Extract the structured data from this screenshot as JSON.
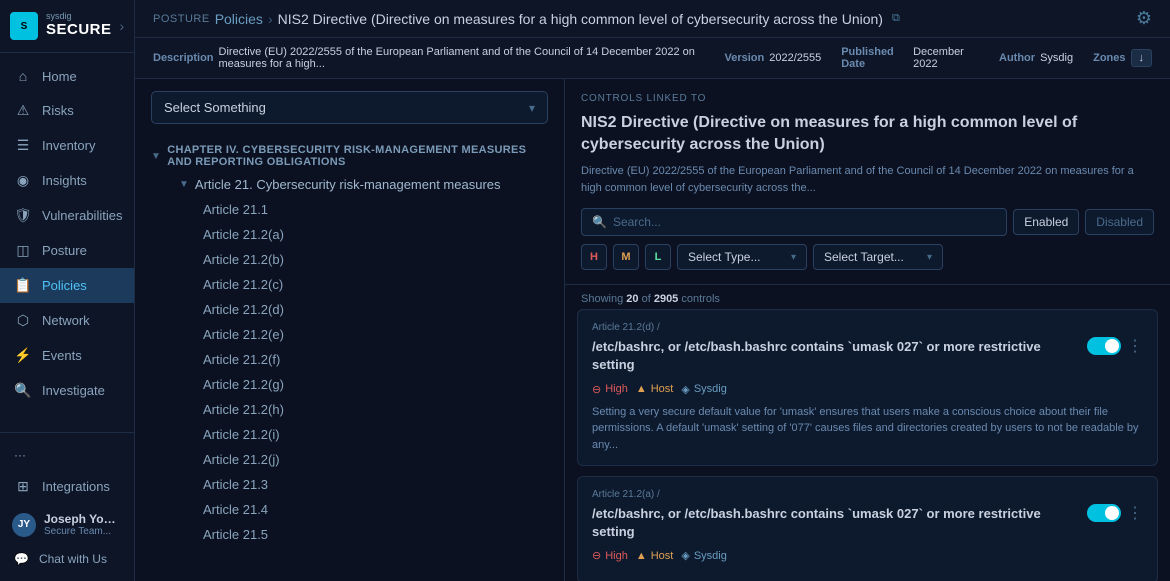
{
  "sidebar": {
    "logo": {
      "icon": "S",
      "brand": "SECURE",
      "sub": "sysdig"
    },
    "toggle_icon": "›",
    "items": [
      {
        "id": "home",
        "label": "Home",
        "icon": "⌂",
        "active": false
      },
      {
        "id": "risks",
        "label": "Risks",
        "icon": "⚠",
        "active": false
      },
      {
        "id": "inventory",
        "label": "Inventory",
        "icon": "☰",
        "active": false
      },
      {
        "id": "insights",
        "label": "Insights",
        "icon": "◉",
        "active": false
      },
      {
        "id": "vulnerabilities",
        "label": "Vulnerabilities",
        "icon": "🛡",
        "active": false
      },
      {
        "id": "posture",
        "label": "Posture",
        "icon": "◫",
        "active": false
      },
      {
        "id": "policies",
        "label": "Policies",
        "icon": "📋",
        "active": true
      },
      {
        "id": "network",
        "label": "Network",
        "icon": "⬡",
        "active": false
      },
      {
        "id": "events",
        "label": "Events",
        "icon": "⚡",
        "active": false
      },
      {
        "id": "investigate",
        "label": "Investigate",
        "icon": "🔍",
        "active": false
      }
    ],
    "bottom_items": [
      {
        "id": "integrations",
        "label": "Integrations",
        "icon": "⊞"
      }
    ],
    "user": {
      "initials": "JY",
      "name": "Joseph Yostos",
      "team": "Secure Team..."
    },
    "chat": {
      "label": "Chat with Us",
      "icon": "💬"
    },
    "dots_icon": "···"
  },
  "topbar": {
    "posture_label": "POSTURE",
    "breadcrumb": {
      "parent": "Policies",
      "separator": "›",
      "current": "NIS2 Directive (Directive on measures for a high common level of cybersecurity across the Union)",
      "ext_icon": "⧉"
    },
    "right_icon": "⚙"
  },
  "info_bar": {
    "description_label": "Description",
    "description_text": "Directive (EU) 2022/2555 of the European Parliament and of the Council of 14 December 2022 on measures for a high...",
    "version_label": "Version",
    "version_value": "2022/2555",
    "published_label": "Published Date",
    "published_value": "December 2022",
    "author_label": "Author",
    "author_value": "Sysdig",
    "zones_label": "Zones",
    "zones_suffix": "↓"
  },
  "left_panel": {
    "select_placeholder": "Select Something",
    "chapter": {
      "label": "CHAPTER IV. CYBERSECURITY RISK-MANAGEMENT MEASURES AND REPORTING OBLIGATIONS",
      "chevron": "▼"
    },
    "article_group": {
      "label": "Article 21. Cybersecurity risk-management measures",
      "chevron": "▼"
    },
    "articles": [
      "Article 21.1",
      "Article 21.2(a)",
      "Article 21.2(b)",
      "Article 21.2(c)",
      "Article 21.2(d)",
      "Article 21.2(e)",
      "Article 21.2(f)",
      "Article 21.2(g)",
      "Article 21.2(h)",
      "Article 21.2(i)",
      "Article 21.2(j)",
      "Article 21.3",
      "Article 21.4",
      "Article 21.5"
    ]
  },
  "right_panel": {
    "controls_label": "CONTROLS LINKED TO",
    "directive_title": "NIS2 Directive (Directive on measures for a high common level of cybersecurity across the Union)",
    "directive_desc": "Directive (EU) 2022/2555 of the European Parliament and of the Council of 14 December 2022 on measures for a high common level of cybersecurity across the...",
    "search_placeholder": "Search...",
    "filter_enabled": "Enabled",
    "filter_disabled": "Disabled",
    "severity_buttons": [
      {
        "label": "H",
        "class": "h"
      },
      {
        "label": "M",
        "class": "m"
      },
      {
        "label": "L",
        "class": "l"
      }
    ],
    "select_type_placeholder": "Select Type...",
    "select_target_placeholder": "Select Target...",
    "showing_text": "Showing",
    "showing_count": "20",
    "showing_of": "of",
    "showing_total": "2905",
    "showing_suffix": "controls",
    "controls": [
      {
        "path": "Article 21.2(d) /",
        "title": "/etc/bashrc, or /etc/bash.bashrc contains `umask 027` or more restrictive setting",
        "toggle_on": true,
        "severity": "High",
        "tag_host": "Host",
        "tag_sysdig": "Sysdig",
        "desc": "Setting a very secure default value for 'umask' ensures that users make a conscious choice about their file permissions. A default 'umask' setting of '077' causes files and directories created by users to not be readable by any..."
      },
      {
        "path": "Article 21.2(a) /",
        "title": "/etc/bashrc, or /etc/bash.bashrc contains `umask 027` or more restrictive setting",
        "toggle_on": true,
        "severity": "High",
        "tag_host": "Host",
        "tag_sysdig": "Sysdig",
        "desc": ""
      }
    ]
  }
}
